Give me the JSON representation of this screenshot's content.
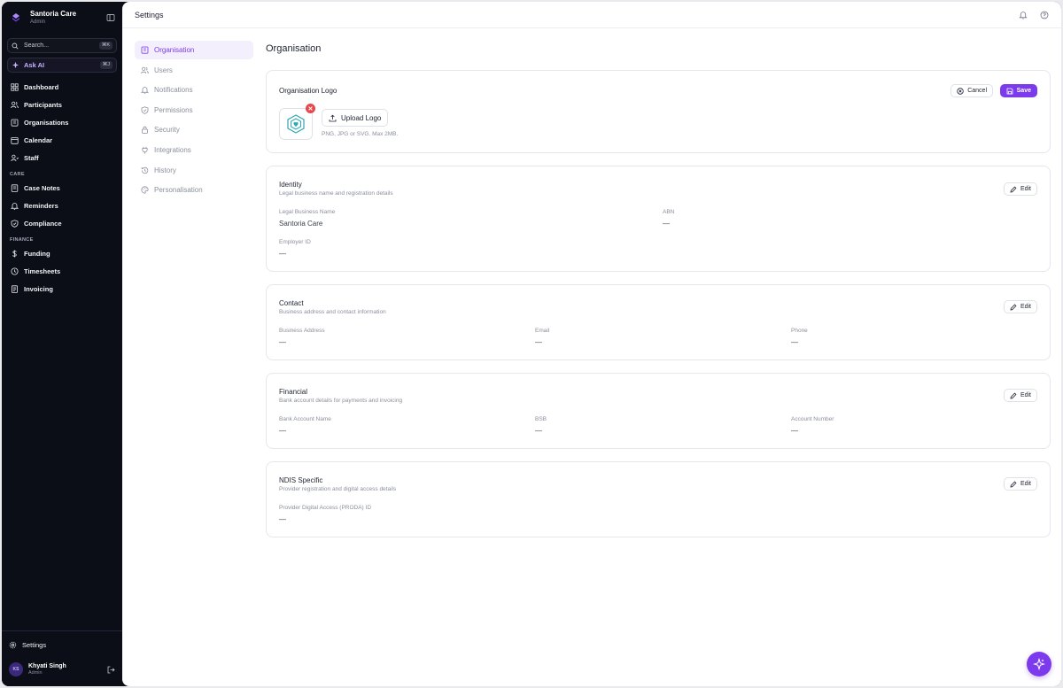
{
  "sidebar": {
    "brand_name": "Santoria Care",
    "brand_role": "Admin",
    "search_placeholder": "Search...",
    "search_shortcut": "⌘K",
    "ask_ai_label": "Ask AI",
    "ask_ai_shortcut": "⌘J",
    "items": [
      {
        "label": "Dashboard",
        "icon": "dashboard-icon"
      },
      {
        "label": "Participants",
        "icon": "users-icon"
      },
      {
        "label": "Organisations",
        "icon": "building-icon"
      },
      {
        "label": "Calendar",
        "icon": "calendar-icon"
      },
      {
        "label": "Staff",
        "icon": "staff-icon"
      }
    ],
    "care_section": "CARE",
    "care_items": [
      {
        "label": "Case Notes",
        "icon": "notes-icon"
      },
      {
        "label": "Reminders",
        "icon": "bell-icon"
      },
      {
        "label": "Compliance",
        "icon": "shield-check-icon"
      }
    ],
    "finance_section": "FINANCE",
    "finance_items": [
      {
        "label": "Funding",
        "icon": "dollar-icon"
      },
      {
        "label": "Timesheets",
        "icon": "clock-icon"
      },
      {
        "label": "Invoicing",
        "icon": "invoice-icon"
      }
    ],
    "settings_label": "Settings",
    "user": {
      "initials": "KS",
      "name": "Khyati Singh",
      "role": "Admin"
    }
  },
  "topbar": {
    "title": "Settings"
  },
  "subnav": {
    "items": [
      {
        "label": "Organisation",
        "active": true
      },
      {
        "label": "Users"
      },
      {
        "label": "Notifications"
      },
      {
        "label": "Permissions"
      },
      {
        "label": "Security"
      },
      {
        "label": "Integrations"
      },
      {
        "label": "History"
      },
      {
        "label": "Personalisation"
      }
    ]
  },
  "panel": {
    "title": "Organisation",
    "logo_card": {
      "title": "Organisation Logo",
      "cancel_label": "Cancel",
      "save_label": "Save",
      "upload_label": "Upload Logo",
      "hint": "PNG, JPG or SVG. Max 2MB."
    },
    "edit_label": "Edit",
    "identity": {
      "title": "Identity",
      "subtitle": "Legal business name and registration details",
      "legal_name_label": "Legal Business Name",
      "legal_name_value": "Santoria Care",
      "abn_label": "ABN",
      "abn_value": "—",
      "employer_id_label": "Employer ID",
      "employer_id_value": "—"
    },
    "contact": {
      "title": "Contact",
      "subtitle": "Business address and contact information",
      "address_label": "Business Address",
      "address_value": "—",
      "email_label": "Email",
      "email_value": "—",
      "phone_label": "Phone",
      "phone_value": "—"
    },
    "financial": {
      "title": "Financial",
      "subtitle": "Bank account details for payments and invoicing",
      "bank_name_label": "Bank Account Name",
      "bank_name_value": "—",
      "bsb_label": "BSB",
      "bsb_value": "—",
      "account_number_label": "Account Number",
      "account_number_value": "—"
    },
    "ndis": {
      "title": "NDIS Specific",
      "subtitle": "Provider registration and digital access details",
      "proda_label": "Provider Digital Access (PRODA) ID",
      "proda_value": "—"
    }
  },
  "colors": {
    "accent": "#7c3aed",
    "sidebar_bg": "#0c0e17",
    "danger": "#e5484d",
    "logo_teal": "#2fa8b5"
  }
}
